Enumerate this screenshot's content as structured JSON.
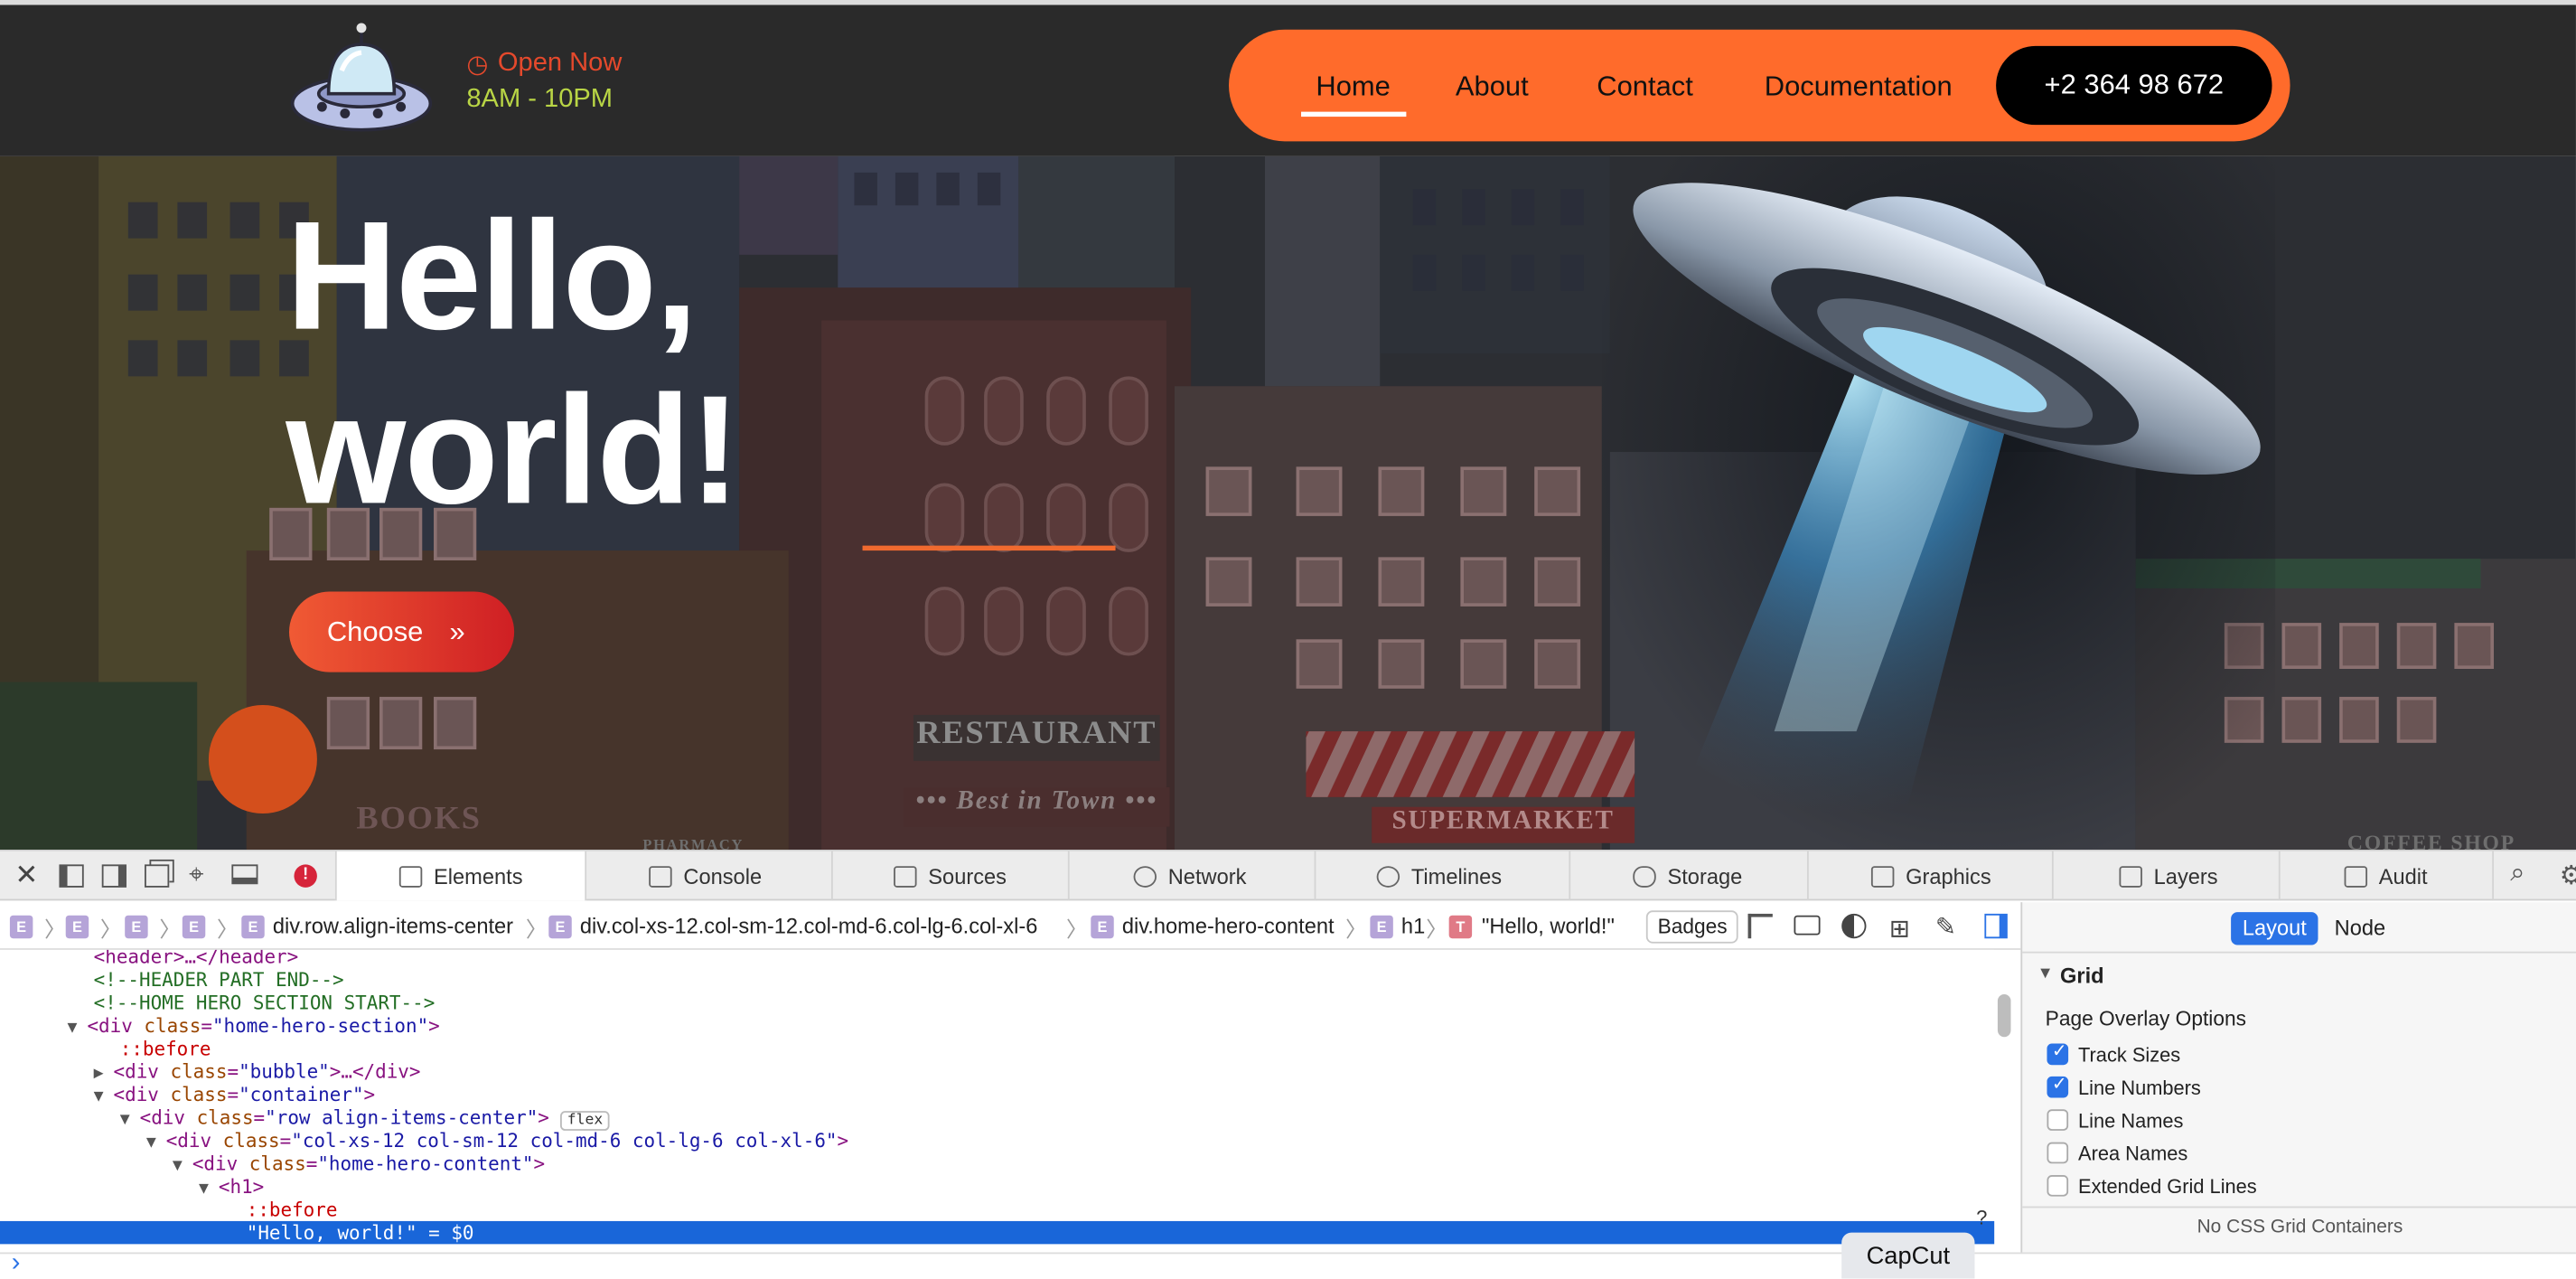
{
  "header": {
    "open_now": "Open Now",
    "hours": "8AM - 10PM",
    "nav": [
      "Home",
      "About",
      "Contact",
      "Documentation"
    ],
    "phone": "+2 364 98 672"
  },
  "hero": {
    "title_line1": "Hello,",
    "title_line2": "world!",
    "cta": "Choose",
    "cta_icon": "»",
    "signs": {
      "restaurant": "RESTAURANT",
      "best_in_town": "••• Best in Town •••",
      "supermarket": "SUPERMARKET",
      "books": "BOOKS",
      "pharmacy": "PHARMACY",
      "coffee_shop": "COFFEE SHOP"
    }
  },
  "devtools": {
    "tabs": [
      "Elements",
      "Console",
      "Sources",
      "Network",
      "Timelines",
      "Storage",
      "Graphics",
      "Layers",
      "Audit"
    ],
    "breadcrumb": [
      "div.row.align-items-center",
      "div.col-xs-12.col-sm-12.col-md-6.col-lg-6.col-xl-6",
      "div.home-hero-content",
      "h1",
      "\"Hello, world!\""
    ],
    "badge_letter": "E",
    "text_badge_letter": "T",
    "badges_label": "Badges",
    "dom": {
      "l0": "<header>…</header>",
      "l1": "<!--HEADER PART END-->",
      "l2": "<!--HOME HERO SECTION START-->",
      "l3_tag": "<div ",
      "l3_attr": "class",
      "l3_val": "\"home-hero-section\"",
      "l4": "::before",
      "l5_tag": "<div ",
      "l5_attr": "class",
      "l5_val": "\"bubble\"",
      "l5_end": ">…</div>",
      "l6_tag": "<div ",
      "l6_attr": "class",
      "l6_val": "\"container\"",
      "l7_tag": "<div ",
      "l7_attr": "class",
      "l7_val": "\"row align-items-center\"",
      "l7_badge": "flex",
      "l8_tag": "<div ",
      "l8_attr": "class",
      "l8_val": "\"col-xs-12 col-sm-12 col-md-6 col-lg-6 col-xl-6\"",
      "l9_tag": "<div ",
      "l9_attr": "class",
      "l9_val": "\"home-hero-content\"",
      "l10": "<h1>",
      "l11": "::before",
      "l12": "\"Hello, world!\" = $0"
    },
    "sidebar": {
      "tab_layout": "Layout",
      "tab_node": "Node",
      "section": "Grid",
      "subsection": "Page Overlay Options",
      "options": [
        {
          "label": "Track Sizes",
          "checked": true
        },
        {
          "label": "Line Numbers",
          "checked": true
        },
        {
          "label": "Line Names",
          "checked": false
        },
        {
          "label": "Area Names",
          "checked": false
        },
        {
          "label": "Extended Grid Lines",
          "checked": false
        }
      ],
      "empty_note": "No CSS Grid Containers"
    },
    "console_prompt": "›"
  },
  "capcut": "CapCut",
  "colors": {
    "accent": "#ff6b2b",
    "header_bg": "#2a2a2a",
    "selection": "#1966d9",
    "badge_purple": "#b5a4d8"
  }
}
